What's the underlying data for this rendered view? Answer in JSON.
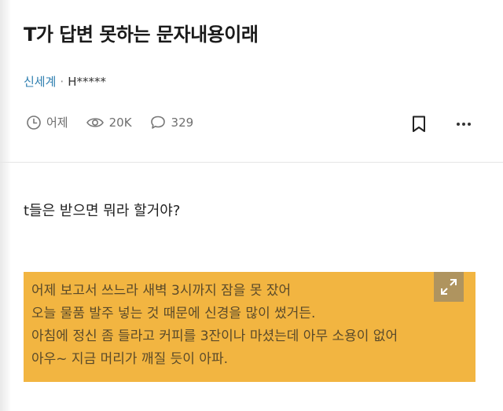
{
  "post": {
    "title": "T가 답변 못하는 문자내용이래"
  },
  "author": {
    "board": "신세계",
    "separator": "·",
    "name": "H*****"
  },
  "meta": {
    "time": "어제",
    "views": "20K",
    "comments": "329",
    "icons": [
      "clock-icon",
      "eye-icon",
      "comment-icon",
      "bookmark-icon",
      "more-icon"
    ]
  },
  "body": {
    "question": "t들은 받으면 뭐라 할거야?",
    "image_lines": [
      "어제 보고서 쓰느라 새벽 3시까지 잠을 못 잤어",
      "오늘 물품 발주 넣는 것 때문에 신경을 많이 썼거든.",
      "아침에 정신 좀 들라고 커피를 3잔이나 마셨는데 아무 소용이 없어",
      "아우~ 지금 머리가 깨질 듯이 아파."
    ],
    "image_background": "#f2b541"
  },
  "colors": {
    "board_link": "#2f7fb0",
    "meta_text": "#6f6f6f"
  }
}
